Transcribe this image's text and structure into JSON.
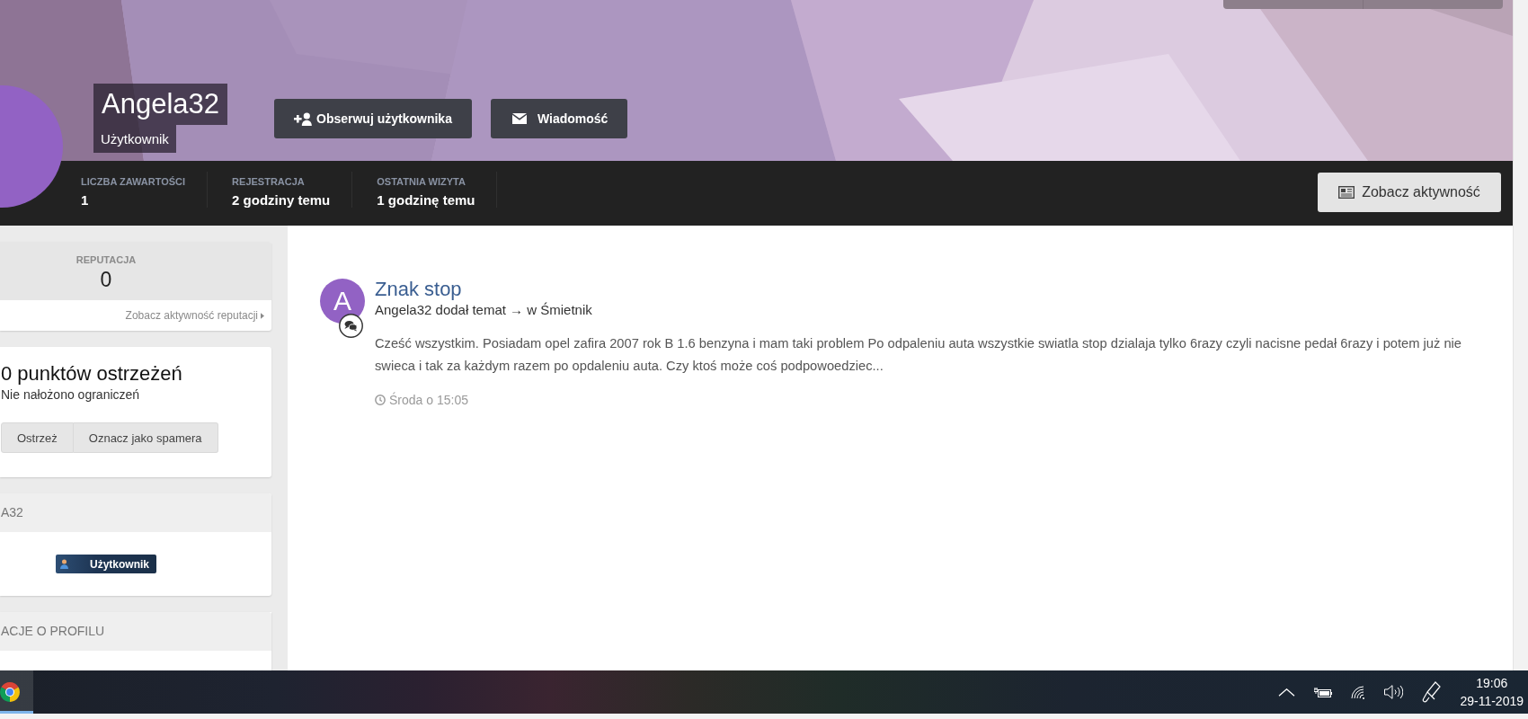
{
  "profile": {
    "name": "Angela32",
    "group": "Użytkownik",
    "actions": [
      {
        "kind": "follow",
        "label": "Obserwuj użytkownika"
      },
      {
        "kind": "message",
        "label": "Wiadomość"
      }
    ]
  },
  "stats": [
    {
      "label": "LICZBA ZAWARTOŚCI",
      "value": "1"
    },
    {
      "label": "REJESTRACJA",
      "value": "2 godziny temu"
    },
    {
      "label": "OSTATNIA WIZYTA",
      "value": "1 godzinę temu"
    }
  ],
  "activity_button": {
    "label": "Zobacz aktywność"
  },
  "sidebar": {
    "reputation": {
      "label": "REPUTACJA",
      "value": "0",
      "link": "Zobacz aktywność reputacji"
    },
    "warnings": {
      "title": "0 punktów ostrzeżeń",
      "subtitle": "Nie nałożono ograniczeń",
      "buttons": [
        "Ostrzeż",
        "Oznacz jako spamera"
      ]
    },
    "group_card": {
      "header": "A32",
      "badge": "Użytkownik"
    },
    "info_card": {
      "header": "ACJE O PROFILU"
    }
  },
  "activity": [
    {
      "avatar_letter": "A",
      "title": "Znak stop",
      "meta": "Angela32 dodał temat → w Śmietnik",
      "excerpt": "Cześć wszystkim. Posiadam opel zafira 2007 rok B 1.6 benzyna i mam taki problem Po odpaleniu auta wszystkie swiatla stop dzialaja tylko 6razy czyli nacisne pedał 6razy i potem już nie swieca i tak za każdym razem po opdaleniu auta. Czy ktoś może coś podpowoedziec...",
      "time": "Środa o 15:05"
    }
  ],
  "taskbar": {
    "apps": [
      {
        "kind": "browser",
        "running": true
      }
    ],
    "time": "19:06",
    "date": "29-11-2019"
  }
}
